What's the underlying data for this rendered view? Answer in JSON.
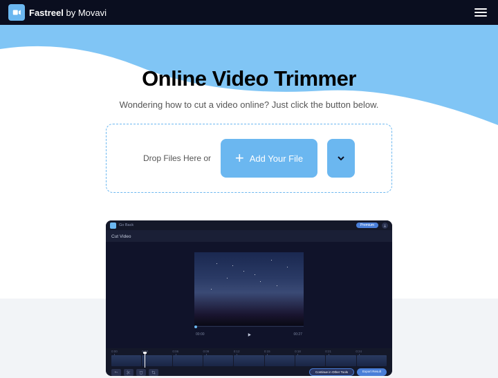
{
  "header": {
    "brand_strong": "Fastreel",
    "brand_rest": " by Movavi"
  },
  "hero": {
    "title": "Online Video Trimmer",
    "subtitle": "Wondering how to cut a video online? Just click the button below."
  },
  "dropzone": {
    "label": "Drop Files Here or",
    "add_button": "Add Your File"
  },
  "preview": {
    "back": "Go Back",
    "premium": "Premium",
    "title": "Cut Video",
    "time_start": "00:00",
    "time_end": "00:27",
    "ticks": [
      "0:00",
      "0:03",
      "0:06",
      "0:09",
      "0:12",
      "0:15",
      "0:18",
      "0:21",
      "0:24"
    ],
    "continue_btn": "Continue in Other Tools",
    "export_btn": "Export Result"
  }
}
